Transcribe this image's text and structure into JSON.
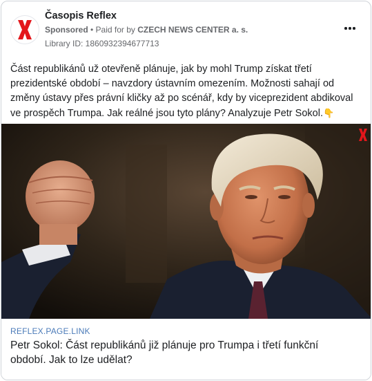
{
  "header": {
    "page_name": "Časopis Reflex",
    "sponsored_label": "Sponsored",
    "separator": " • ",
    "paid_for_text": "Paid for by ",
    "advertiser": "CZECH NEWS CENTER a. s.",
    "library_id": "Library ID: 1860932394677713",
    "logo_icon": "reflex-x-logo",
    "more_icon": "more-options-icon"
  },
  "post": {
    "text": "Část republikánů už otevřeně plánuje, jak by mohl Trump získat třetí prezidentské období – navzdory ústavním omezením. Možnosti sahají od změny ústavy přes právní kličky až po scénář, kdy by viceprezident abdikoval ve prospěch Trumpa. Jak reálné jsou tyto plány? Analyzuje Petr Sokol.",
    "emoji": "👇"
  },
  "link": {
    "domain": "REFLEX.PAGE.LINK",
    "title": "Petr Sokol: Část republikánů již plánuje pro Trumpa i třetí funkční období. Jak to lze udělat?"
  },
  "colors": {
    "brand_red": "#e3161b",
    "link_domain": "#4a7ab8",
    "secondary_text": "#65676b"
  }
}
